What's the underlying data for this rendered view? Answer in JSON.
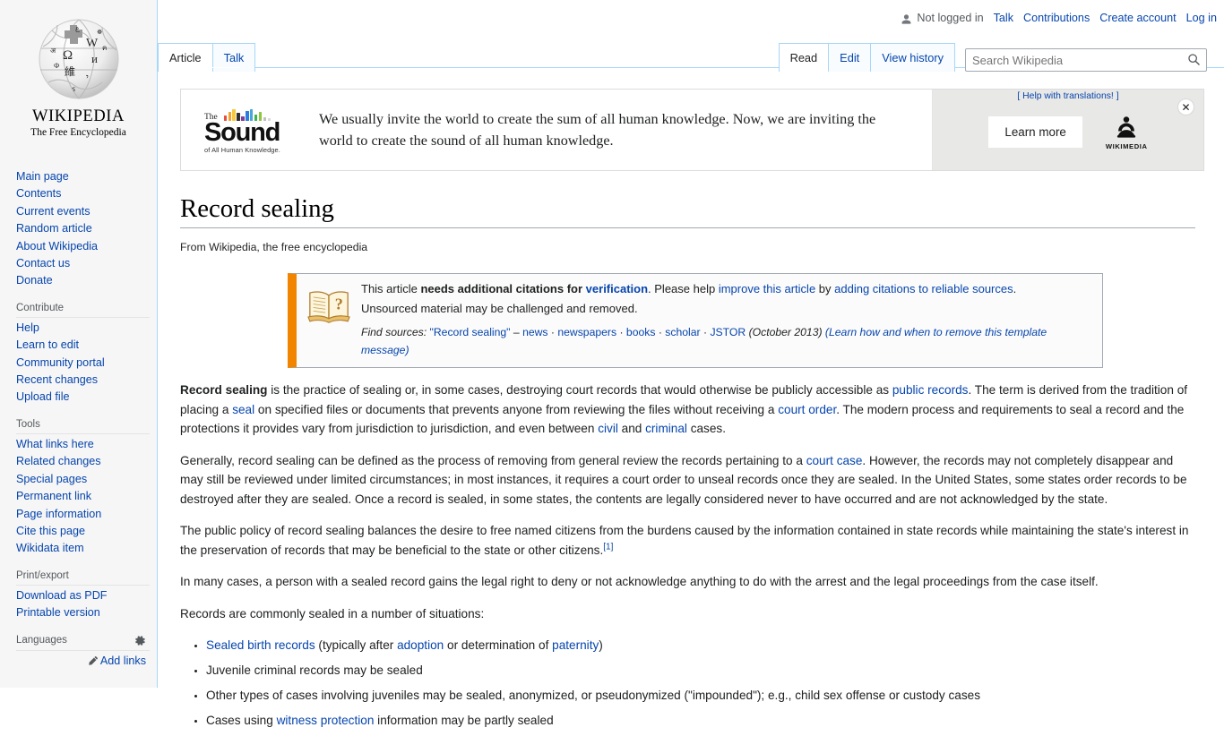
{
  "personal_bar": {
    "not_logged_in": "Not logged in",
    "user_icon": "user-icon",
    "links": [
      "Talk",
      "Contributions",
      "Create account",
      "Log in"
    ]
  },
  "logo": {
    "wordmark": "WIKIPEDIA",
    "tagline": "The Free Encyclopedia",
    "globe_icon": "wikipedia-globe-puzzle-icon"
  },
  "sidebar": {
    "navigation": {
      "heading": "",
      "items": [
        "Main page",
        "Contents",
        "Current events",
        "Random article",
        "About Wikipedia",
        "Contact us",
        "Donate"
      ]
    },
    "contribute": {
      "heading": "Contribute",
      "items": [
        "Help",
        "Learn to edit",
        "Community portal",
        "Recent changes",
        "Upload file"
      ]
    },
    "tools": {
      "heading": "Tools",
      "items": [
        "What links here",
        "Related changes",
        "Special pages",
        "Permanent link",
        "Page information",
        "Cite this page",
        "Wikidata item"
      ]
    },
    "print_export": {
      "heading": "Print/export",
      "items": [
        "Download as PDF",
        "Printable version"
      ]
    },
    "languages": {
      "heading": "Languages",
      "gear_icon": "gear-icon",
      "add_links": "Add links",
      "pencil_icon": "pencil-icon"
    }
  },
  "namespace_tabs": [
    {
      "label": "Article",
      "selected": true
    },
    {
      "label": "Talk",
      "selected": false
    }
  ],
  "view_tabs": [
    {
      "label": "Read",
      "selected": true
    },
    {
      "label": "Edit",
      "selected": false
    },
    {
      "label": "View history",
      "selected": false
    }
  ],
  "search": {
    "placeholder": "Search Wikipedia",
    "value": "",
    "icon": "search-icon"
  },
  "banner": {
    "logo": {
      "the": "The",
      "sound": "Sound",
      "subtitle": "of All Human Knowledge.",
      "bar_colors": [
        "#e94f3c",
        "#f0a22e",
        "#f5c842",
        "#2d2d2d",
        "#7d3f98",
        "#2a7de1",
        "#4aa5d9",
        "#3fb34f",
        "#8dc63f",
        "#bfbfbf",
        "#d9d9d9"
      ]
    },
    "message": "We usually invite the world to create the sum of all human knowledge. Now, we are inviting the world to create the sound of all human knowledge.",
    "help_translate": "[ Help with translations! ]",
    "help_translate_label": "Help with translations!",
    "learn_more": "Learn more",
    "wikimedia_label": "WIKIMEDIA",
    "wikimedia_icon": "wikimedia-foundation-icon",
    "close_icon": "close-icon",
    "close_glyph": "✕",
    "side_bg": "#e8e8e6"
  },
  "article": {
    "title": "Record sealing",
    "site_sub": "From Wikipedia, the free encyclopedia",
    "ambox": {
      "icon": "open-book-question-icon",
      "accent_color": "#f28500",
      "line1_a": "This article ",
      "line1_b": "needs additional citations for ",
      "line1_verification": "verification",
      "line1_c": ". Please help ",
      "line1_improve": "improve this article",
      "line1_d": " by ",
      "line1_sources": "adding citations to reliable sources",
      "line1_e": ".",
      "line2": "Unsourced material may be challenged and removed.",
      "find_sources_label": "Find sources:",
      "find_sources_query": "\"Record sealing\"",
      "dash": "–",
      "source_links": [
        "news",
        "newspapers",
        "books",
        "scholar",
        "JSTOR"
      ],
      "date": "(October 2013)",
      "remove_note": "(Learn how and when to remove this template message)"
    },
    "paragraphs": [
      {
        "parts": [
          {
            "t": "Record sealing",
            "s": "bold"
          },
          {
            "t": " is the practice of sealing or, in some cases, destroying court records that would otherwise be publicly accessible as "
          },
          {
            "t": "public records",
            "s": "link"
          },
          {
            "t": ". The term is derived from the tradition of placing a "
          },
          {
            "t": "seal",
            "s": "link"
          },
          {
            "t": " on specified files or documents that prevents anyone from reviewing the files without receiving a "
          },
          {
            "t": "court order",
            "s": "link"
          },
          {
            "t": ". The modern process and requirements to seal a record and the protections it provides vary from jurisdiction to jurisdiction, and even between "
          },
          {
            "t": "civil",
            "s": "link"
          },
          {
            "t": " and "
          },
          {
            "t": "criminal",
            "s": "link"
          },
          {
            "t": " cases."
          }
        ]
      },
      {
        "parts": [
          {
            "t": "Generally, record sealing can be defined as the process of removing from general review the records pertaining to a "
          },
          {
            "t": "court case",
            "s": "link"
          },
          {
            "t": ". However, the records may not completely disappear and may still be reviewed under limited circumstances; in most instances, it requires a court order to unseal records once they are sealed. In the United States, some states order records to be destroyed after they are sealed. Once a record is sealed, in some states, the contents are legally considered never to have occurred and are not acknowledged by the state."
          }
        ]
      },
      {
        "parts": [
          {
            "t": "The public policy of record sealing balances the desire to free named citizens from the burdens caused by the information contained in state records while maintaining the state's interest in the preservation of records that may be beneficial to the state or other citizens."
          },
          {
            "t": "[1]",
            "s": "ref"
          }
        ]
      },
      {
        "parts": [
          {
            "t": "In many cases, a person with a sealed record gains the legal right to deny or not acknowledge anything to do with the arrest and the legal proceedings from the case itself."
          }
        ]
      },
      {
        "parts": [
          {
            "t": "Records are commonly sealed in a number of situations:"
          }
        ]
      }
    ],
    "bullets": [
      {
        "parts": [
          {
            "t": "Sealed birth records",
            "s": "link"
          },
          {
            "t": " (typically after "
          },
          {
            "t": "adoption",
            "s": "link"
          },
          {
            "t": " or determination of "
          },
          {
            "t": "paternity",
            "s": "link"
          },
          {
            "t": ")"
          }
        ]
      },
      {
        "parts": [
          {
            "t": "Juvenile criminal records may be sealed"
          }
        ]
      },
      {
        "parts": [
          {
            "t": "Other types of cases involving juveniles may be sealed, anonymized, or pseudonymized (\"impounded\"); e.g., child sex offense or custody cases"
          }
        ]
      },
      {
        "parts": [
          {
            "t": "Cases using "
          },
          {
            "t": "witness protection",
            "s": "link"
          },
          {
            "t": " information may be partly sealed"
          }
        ]
      }
    ]
  },
  "colors": {
    "link": "#0645ad",
    "sidebar_bg": "#f6f6f6",
    "tab_border": "#a7d7f9",
    "ambox_accent": "#f28500"
  }
}
